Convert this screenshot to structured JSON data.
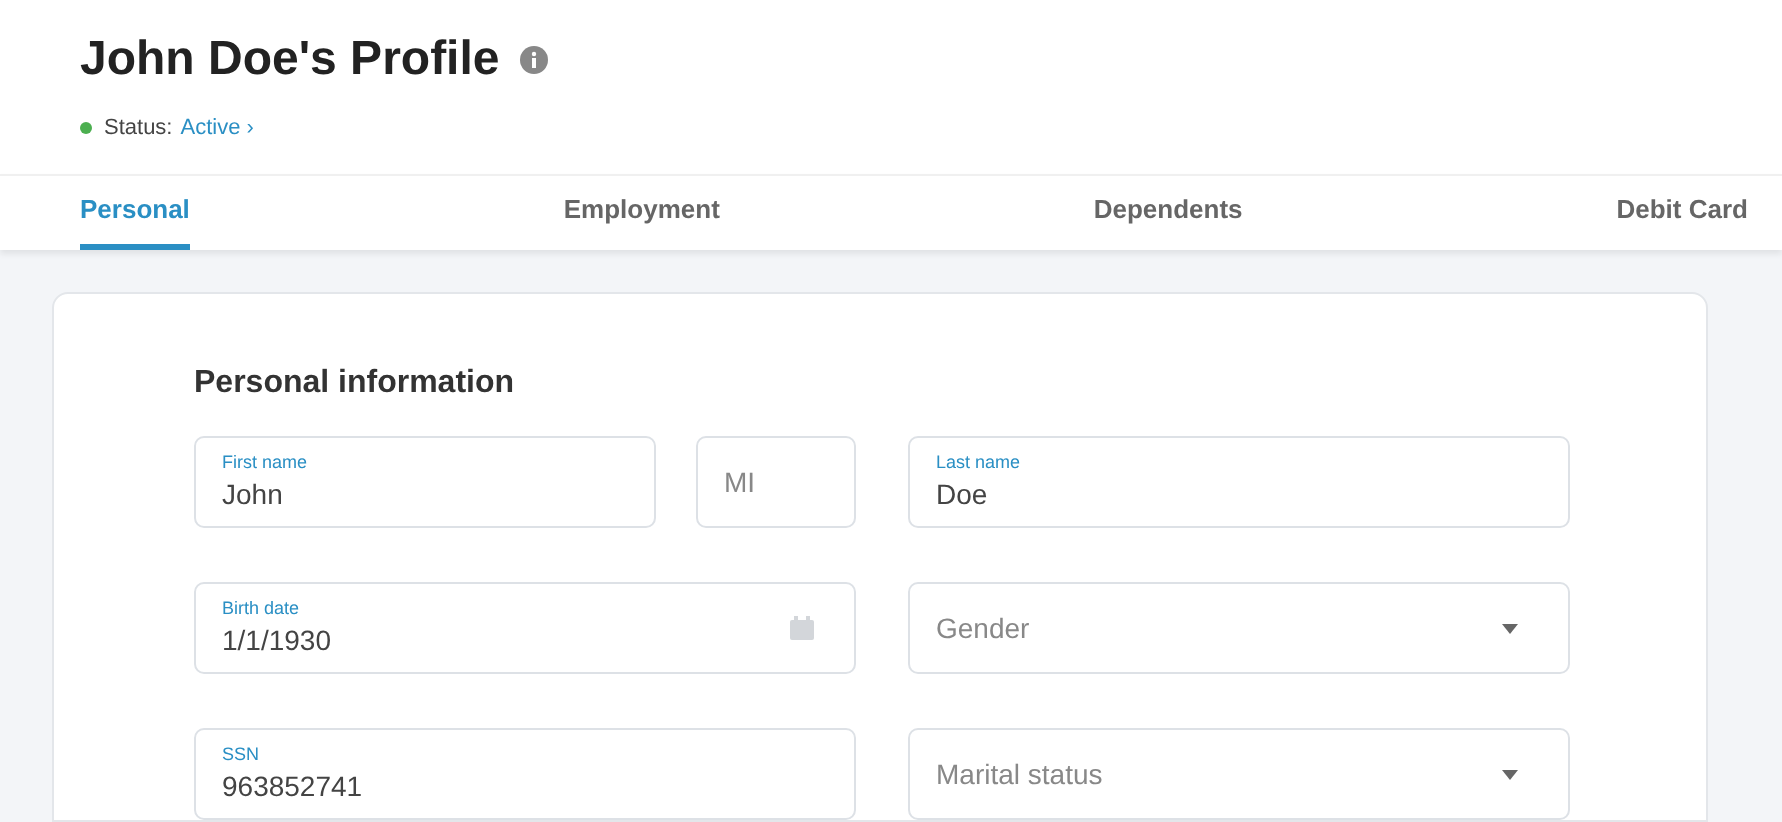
{
  "header": {
    "title": "John Doe's Profile",
    "status_label": "Status:",
    "status_value": "Active",
    "status_arrow": "›"
  },
  "tabs": [
    {
      "label": "Personal",
      "selected": true
    },
    {
      "label": "Employment",
      "selected": false
    },
    {
      "label": "Dependents",
      "selected": false
    },
    {
      "label": "Debit Card",
      "selected": false
    }
  ],
  "card": {
    "heading": "Personal information",
    "rows": [
      [
        {
          "kind": "text",
          "label": "First name",
          "value": "John"
        },
        {
          "kind": "text",
          "placeholder": "MI"
        },
        {
          "kind": "text",
          "label": "Last name",
          "value": "Doe"
        }
      ],
      [
        {
          "kind": "date",
          "label": "Birth date",
          "value": "1/1/1930"
        },
        {
          "kind": "select",
          "placeholder": "Gender"
        }
      ],
      [
        {
          "kind": "text",
          "label": "SSN",
          "value": "963852741"
        },
        {
          "kind": "select",
          "placeholder": "Marital status"
        }
      ]
    ]
  }
}
